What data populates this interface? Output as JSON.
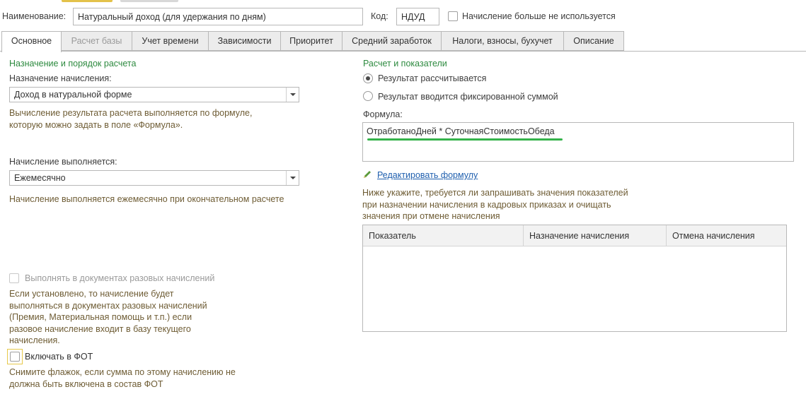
{
  "header": {
    "name_label": "Наименование:",
    "name_value": "Натуральный доход (для удержания по дням)",
    "code_label": "Код:",
    "code_value": "НДУД",
    "not_used_label": "Начисление больше не используется",
    "not_used_checked": false
  },
  "tabs": [
    {
      "label": "Основное",
      "active": true,
      "enabled": true
    },
    {
      "label": "Расчет базы",
      "active": false,
      "enabled": false
    },
    {
      "label": "Учет времени",
      "active": false,
      "enabled": true
    },
    {
      "label": "Зависимости",
      "active": false,
      "enabled": true
    },
    {
      "label": "Приоритет",
      "active": false,
      "enabled": true
    },
    {
      "label": "Средний заработок",
      "active": false,
      "enabled": true
    },
    {
      "label": "Налоги, взносы, бухучет",
      "active": false,
      "enabled": true
    },
    {
      "label": "Описание",
      "active": false,
      "enabled": true
    }
  ],
  "left": {
    "section_title": "Назначение и порядок расчета",
    "purpose_label": "Назначение начисления:",
    "purpose_value": "Доход в натуральной форме",
    "purpose_hint_1": "Вычисление результата расчета выполняется по формуле,",
    "purpose_hint_2": "которую можно задать в поле «Формула».",
    "execution_label": "Начисление выполняется:",
    "execution_value": "Ежемесячно",
    "execution_hint": "Начисление выполняется ежемесячно при окончательном расчете",
    "one_time_label": "Выполнять в документах разовых начислений",
    "one_time_hint_1": "Если установлено, то начисление будет",
    "one_time_hint_2": "выполняться в документах разовых начислений",
    "one_time_hint_3": "(Премия, Материальная помощь и т.п.) если",
    "one_time_hint_4": "разовое начисление входит в базу текущего",
    "one_time_hint_5": "начисления.",
    "fot_label": "Включать в ФОТ",
    "fot_checked": false,
    "fot_hint_1": "Снимите флажок, если сумма по этому начислению не",
    "fot_hint_2": "должна быть включена в состав ФОТ"
  },
  "right": {
    "section_title": "Расчет и показатели",
    "radio_calculated": "Результат рассчитывается",
    "radio_fixed": "Результат вводится фиксированной суммой",
    "selected_radio": "calculated",
    "formula_label": "Формула:",
    "formula_value": "ОтработаноДней * СуточнаяСтоимостьОбеда",
    "edit_formula_link": "Редактировать формулу",
    "indicators_hint_1": "Ниже укажите, требуется ли запрашивать значения показателей",
    "indicators_hint_2": "при назначении начисления в кадровых приказах и очищать",
    "indicators_hint_3": "значения при отмене начисления",
    "table_columns": [
      "Показатель",
      "Назначение начисления",
      "Отмена начисления"
    ],
    "table_rows": []
  },
  "colors": {
    "section_title": "#2d8a3f",
    "hint_text": "#6e5c34",
    "link": "#1f5fae",
    "highlight_underline": "#34b34a",
    "focus_border": "#e6c84a"
  }
}
